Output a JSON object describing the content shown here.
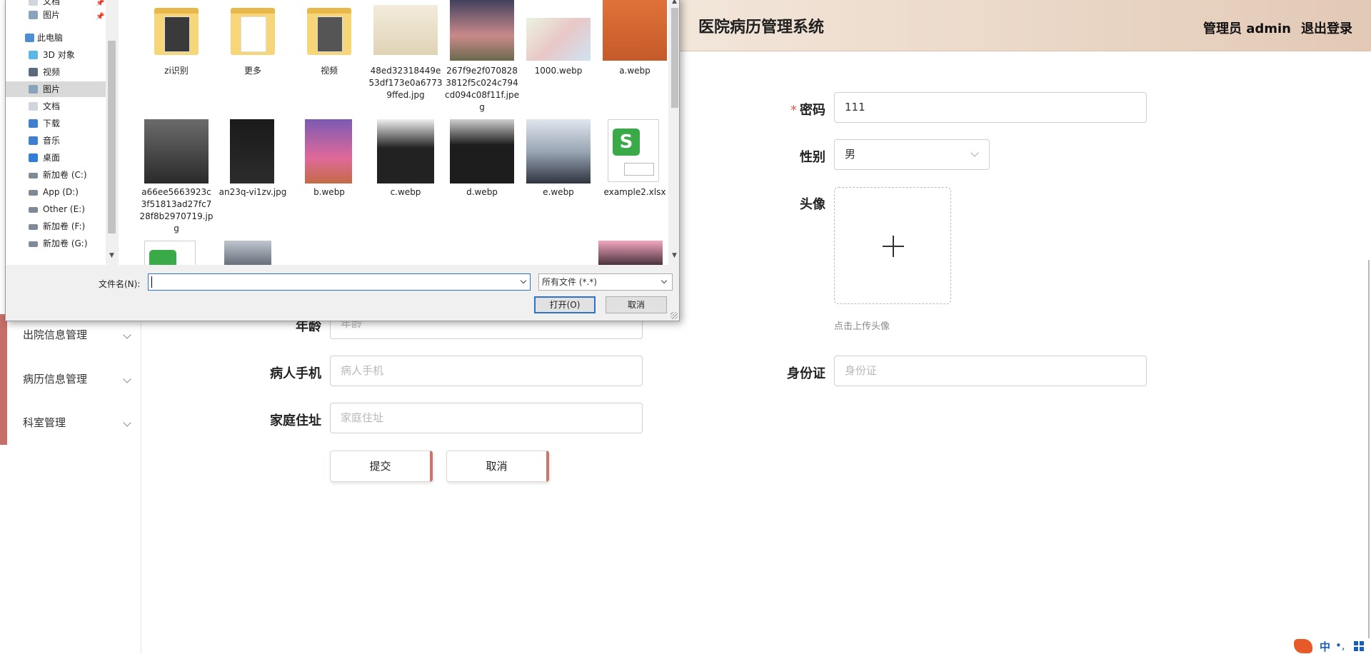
{
  "header": {
    "title": "医院病历管理系统",
    "user": "管理员 admin",
    "logout": "退出登录"
  },
  "sidebar": {
    "items": [
      {
        "label": "出院信息管理"
      },
      {
        "label": "病历信息管理"
      },
      {
        "label": "科室管理"
      }
    ]
  },
  "form": {
    "password": {
      "label": "密码",
      "value": "111"
    },
    "gender": {
      "label": "性别",
      "value": "男"
    },
    "avatar": {
      "label": "头像",
      "hint": "点击上传头像"
    },
    "age": {
      "label": "年龄",
      "placeholder": "年龄"
    },
    "phone": {
      "label": "病人手机",
      "placeholder": "病人手机"
    },
    "idcard": {
      "label": "身份证",
      "placeholder": "身份证"
    },
    "address": {
      "label": "家庭住址",
      "placeholder": "家庭住址"
    },
    "submit": "提交",
    "cancel": "取消"
  },
  "dialog": {
    "nav": [
      {
        "label": "文档",
        "icon": "doc-icon"
      },
      {
        "label": "图片",
        "icon": "picture-icon"
      },
      {
        "label": "此电脑",
        "icon": "computer-icon"
      },
      {
        "label": "3D 对象",
        "icon": "cube-icon"
      },
      {
        "label": "视频",
        "icon": "video-icon"
      },
      {
        "label": "图片",
        "icon": "picture-icon"
      },
      {
        "label": "文档",
        "icon": "doc-icon"
      },
      {
        "label": "下载",
        "icon": "download-icon"
      },
      {
        "label": "音乐",
        "icon": "music-icon"
      },
      {
        "label": "桌面",
        "icon": "desktop-icon"
      },
      {
        "label": "新加卷 (C:)",
        "icon": "drive-icon"
      },
      {
        "label": "App (D:)",
        "icon": "drive-icon"
      },
      {
        "label": "Other (E:)",
        "icon": "drive-icon"
      },
      {
        "label": "新加卷 (F:)",
        "icon": "drive-icon"
      },
      {
        "label": "新加卷 (G:)",
        "icon": "drive-icon"
      }
    ],
    "files_row1": [
      {
        "name": "zi识别",
        "kind": "folder"
      },
      {
        "name": "更多",
        "kind": "folder"
      },
      {
        "name": "视频",
        "kind": "folder"
      },
      {
        "name": "48ed32318449e53df173e0a67739ffed.jpg",
        "kind": "image"
      },
      {
        "name": "267f9e2f0708283812f5c024c794cd094c08f11f.jpeg",
        "kind": "image"
      },
      {
        "name": "1000.webp",
        "kind": "image"
      },
      {
        "name": "a.webp",
        "kind": "image"
      }
    ],
    "files_row2": [
      {
        "name": "a66ee5663923c3f51813ad27fc728f8b2970719.jpg",
        "kind": "image"
      },
      {
        "name": "an23q-vi1zv.jpg",
        "kind": "image"
      },
      {
        "name": "b.webp",
        "kind": "image"
      },
      {
        "name": "c.webp",
        "kind": "image"
      },
      {
        "name": "d.webp",
        "kind": "image"
      },
      {
        "name": "e.webp",
        "kind": "image"
      },
      {
        "name": "example2.xlsx",
        "kind": "sheet"
      }
    ],
    "filename_label": "文件名(N):",
    "filename_value": "",
    "filter": "所有文件 (*.*)",
    "open": "打开(O)",
    "cancel": "取消"
  },
  "tray": {
    "ime_lang": "中",
    "ime_punct": "•,",
    "brand_color": "#e8592a"
  }
}
